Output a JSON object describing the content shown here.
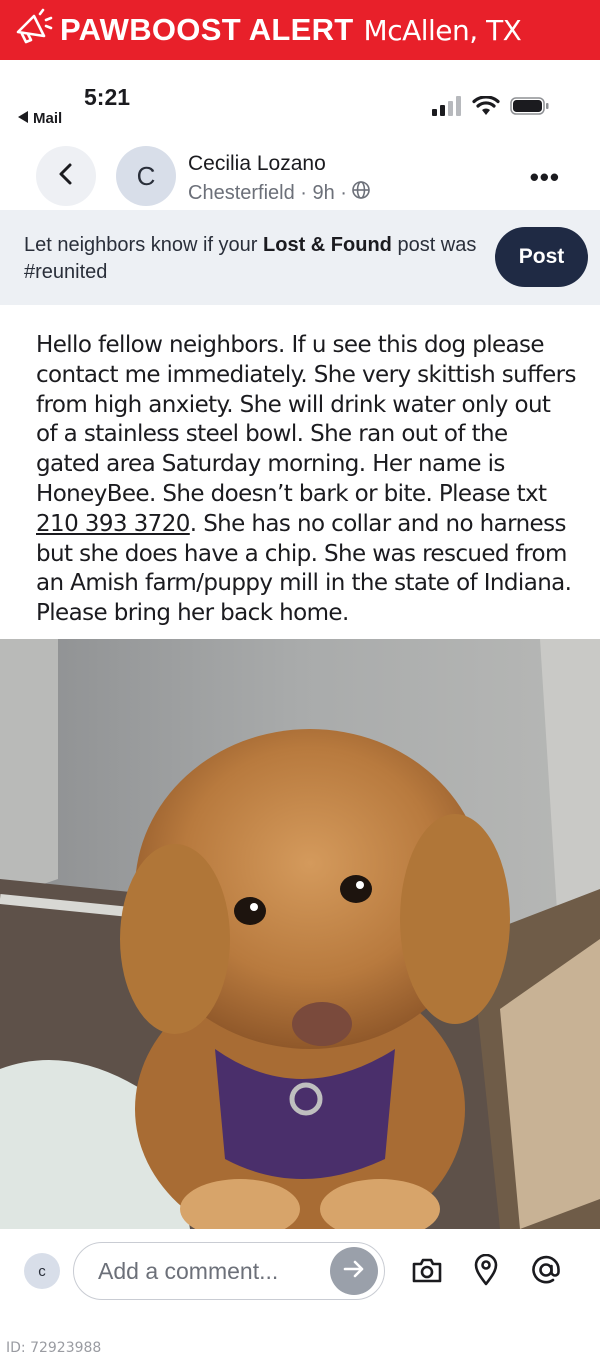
{
  "alert": {
    "title": "PAWBOOST ALERT",
    "location": "McAllen, TX",
    "bg_color": "#e8202a",
    "icon": "megaphone-icon"
  },
  "status_bar": {
    "time": "5:21",
    "back_app": "Mail",
    "icons": [
      "signal-icon",
      "wifi-icon",
      "battery-icon"
    ]
  },
  "post_header": {
    "avatar_initial": "C",
    "author": "Cecilia Lozano",
    "meta": "Chesterfield · 9h ·",
    "privacy_icon": "globe-icon"
  },
  "reunite_banner": {
    "text_before": "Let neighbors know if your ",
    "text_bold": "Lost & Found",
    "text_after": " post was #reunited",
    "button": "Post",
    "button_color": "#1f2a44"
  },
  "post": {
    "body_before": "Hello fellow neighbors.  If u see this dog please contact me immediately. She very skittish suffers from high anxiety. She will drink water only out of a stainless steel bowl.  She ran out of the gated area Saturday morning. Her name is HoneyBee. She doesn’t bark or bite. Please txt ",
    "phone": "210 393 3720",
    "body_after": ". She has no collar and no harness but she does have a chip. She was rescued from an Amish farm/puppy mill in the state of Indiana. Please bring her back home."
  },
  "photo": {
    "subject": "dog-photo"
  },
  "comment_bar": {
    "avatar_initial": "c",
    "placeholder": "Add a comment...",
    "icons": [
      "camera-icon",
      "location-pin-icon",
      "mention-icon"
    ]
  },
  "footer": {
    "id": "ID: 72923988"
  }
}
